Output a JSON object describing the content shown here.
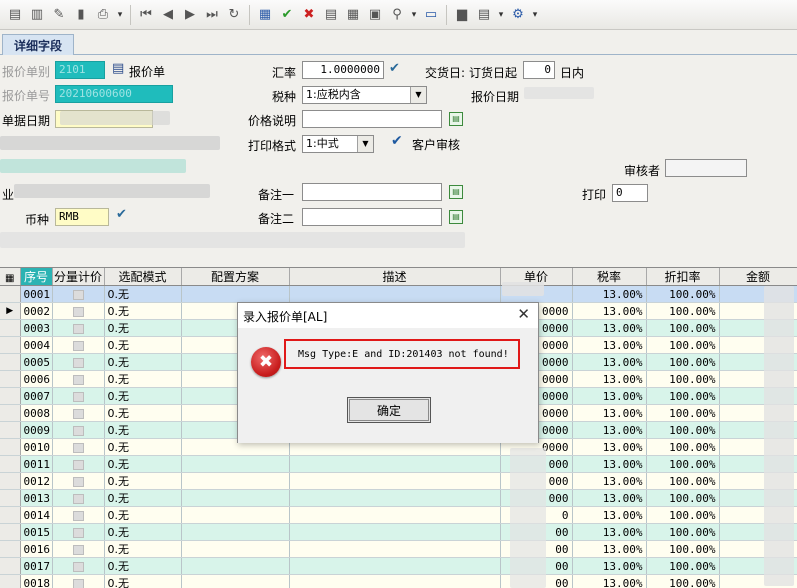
{
  "toolbar": {
    "icons": [
      "new-doc-icon",
      "copy-doc-icon",
      "edit-icon",
      "delete-icon",
      "print-icon",
      "first-icon",
      "prev-icon",
      "next-icon",
      "last-icon",
      "refresh-icon",
      "calculator-icon",
      "approve-icon",
      "reject-icon",
      "export-icon",
      "grid-icon",
      "preview-icon",
      "search-icon",
      "attach-icon",
      "folder-icon",
      "list-icon",
      "settings-icon"
    ],
    "dropdown_glyph": "▾",
    "new_glyph": "▤",
    "copy_glyph": "▥",
    "edit_glyph": "✎",
    "delete_glyph": "▮",
    "print_glyph": "⎙",
    "first_glyph": "⏮",
    "prev_glyph": "◀",
    "next_glyph": "▶",
    "last_glyph": "⏭",
    "refresh_glyph": "↻",
    "calc_glyph": "▦",
    "approve_glyph": "✔",
    "reject_glyph": "✖",
    "export_glyph": "▤",
    "grid_glyph": "▦",
    "preview_glyph": "▣",
    "search_glyph": "⚲",
    "attach_glyph": "▭",
    "folder_glyph": "▆",
    "list_glyph": "▤",
    "settings_glyph": "⚙"
  },
  "tab": {
    "label": "详细字段"
  },
  "form": {
    "quote_type_label": "报价单别",
    "quote_type_value": "2101",
    "quote_btn_label": "报价单",
    "quote_no_label": "报价单号",
    "quote_no_value": "20210600600",
    "doc_date_label": "单据日期",
    "rate_label": "汇率",
    "rate_value": "1.0000000",
    "delivery_label": "交货日:",
    "delivery_from_label": "订货日起",
    "delivery_days_value": "0",
    "delivery_unit_label": "日内",
    "tax_label": "税种",
    "tax_value": "1:应税内含",
    "quote_date_label": "报价日期",
    "price_desc_label": "价格说明",
    "print_format_label": "打印格式",
    "print_format_value": "1:中式",
    "customer_audit_label": "客户审核",
    "check_glyph": "✔",
    "reviewer_label": "审核者",
    "print_label": "打印",
    "print_value": "0",
    "remark1_label": "备注一",
    "remark2_label": "备注二",
    "currency_label": "币种",
    "currency_value": "RMB",
    "biz_fragment": "业",
    "pick_glyph": "▤",
    "combo_glyph": "▼"
  },
  "grid": {
    "headers": [
      "序号",
      "分量计价",
      "选配模式",
      "配置方案",
      "描述",
      "单价",
      "税率",
      "折扣率",
      "金额"
    ],
    "current_glyph": "▶",
    "rows": [
      {
        "seq": "0001",
        "mode": "0.无",
        "price": "",
        "tax": "13.00%",
        "disc": "100.00%"
      },
      {
        "seq": "0002",
        "mode": "0.无",
        "price": "0000",
        "tax": "13.00%",
        "disc": "100.00%"
      },
      {
        "seq": "0003",
        "mode": "0.无",
        "price": "0000",
        "tax": "13.00%",
        "disc": "100.00%"
      },
      {
        "seq": "0004",
        "mode": "0.无",
        "price": "0000",
        "tax": "13.00%",
        "disc": "100.00%"
      },
      {
        "seq": "0005",
        "mode": "0.无",
        "price": "0000",
        "tax": "13.00%",
        "disc": "100.00%"
      },
      {
        "seq": "0006",
        "mode": "0.无",
        "price": "0000",
        "tax": "13.00%",
        "disc": "100.00%"
      },
      {
        "seq": "0007",
        "mode": "0.无",
        "price": "0000",
        "tax": "13.00%",
        "disc": "100.00%"
      },
      {
        "seq": "0008",
        "mode": "0.无",
        "price": "0000",
        "tax": "13.00%",
        "disc": "100.00%"
      },
      {
        "seq": "0009",
        "mode": "0.无",
        "price": "0000",
        "tax": "13.00%",
        "disc": "100.00%"
      },
      {
        "seq": "0010",
        "mode": "0.无",
        "price": "0000",
        "tax": "13.00%",
        "disc": "100.00%"
      },
      {
        "seq": "0011",
        "mode": "0.无",
        "price": "000",
        "tax": "13.00%",
        "disc": "100.00%"
      },
      {
        "seq": "0012",
        "mode": "0.无",
        "price": "000",
        "tax": "13.00%",
        "disc": "100.00%"
      },
      {
        "seq": "0013",
        "mode": "0.无",
        "price": "000",
        "tax": "13.00%",
        "disc": "100.00%"
      },
      {
        "seq": "0014",
        "mode": "0.无",
        "price": "0",
        "tax": "13.00%",
        "disc": "100.00%"
      },
      {
        "seq": "0015",
        "mode": "0.无",
        "price": "00",
        "tax": "13.00%",
        "disc": "100.00%"
      },
      {
        "seq": "0016",
        "mode": "0.无",
        "price": "00",
        "tax": "13.00%",
        "disc": "100.00%"
      },
      {
        "seq": "0017",
        "mode": "0.无",
        "price": "00",
        "tax": "13.00%",
        "disc": "100.00%"
      },
      {
        "seq": "0018",
        "mode": "0.无",
        "price": "00",
        "tax": "13.00%",
        "disc": "100.00%"
      }
    ]
  },
  "dialog": {
    "title": "录入报价单[AL]",
    "close_glyph": "✕",
    "error_glyph": "✖",
    "message": "Msg Type:E and ID:201403 not found!",
    "ok_label": "确定"
  },
  "colors": {
    "teal": "#1fbcbc",
    "yellow": "#fffcc6",
    "row_green": "#d8f4ea",
    "row_cream": "#fffef0",
    "error_red": "#e01818"
  }
}
